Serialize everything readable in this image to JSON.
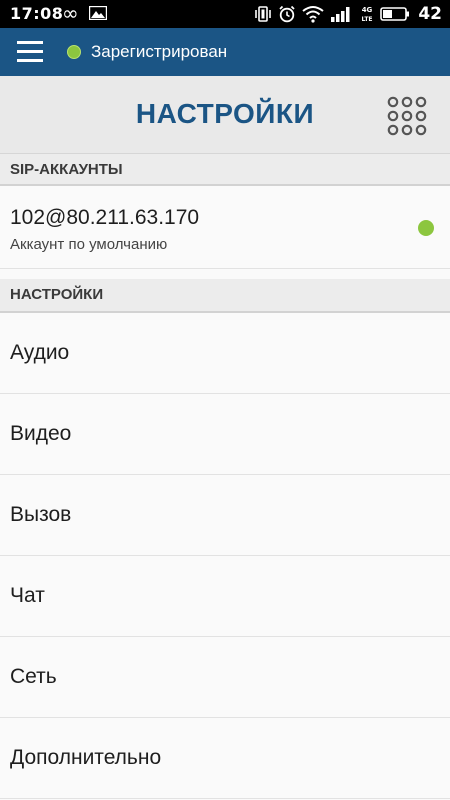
{
  "status_bar": {
    "time": "17:08",
    "infinity_symbol": "∞",
    "network_label_top": "4G",
    "network_label_bottom": "LTE",
    "battery_level": "42",
    "icons": [
      "infinity-icon",
      "gallery-icon",
      "vibrate-icon",
      "alarm-icon",
      "wifi-icon",
      "signal-icon",
      "battery-icon"
    ]
  },
  "app_bar": {
    "registration_status": "Зарегистрирован",
    "status_color": "#8cc63f",
    "background_color": "#1b5585"
  },
  "page": {
    "title": "НАСТРОЙКИ",
    "title_color": "#1b5585"
  },
  "sip_section": {
    "header": "SIP-АККАУНТЫ",
    "account": {
      "name": "102@80.211.63.170",
      "subtitle": "Аккаунт по умолчанию",
      "status_color": "#8cc63f"
    }
  },
  "settings_section": {
    "header": "НАСТРОЙКИ",
    "items": [
      {
        "label": "Аудио"
      },
      {
        "label": "Видео"
      },
      {
        "label": "Вызов"
      },
      {
        "label": "Чат"
      },
      {
        "label": "Сеть"
      },
      {
        "label": "Дополнительно"
      }
    ]
  }
}
